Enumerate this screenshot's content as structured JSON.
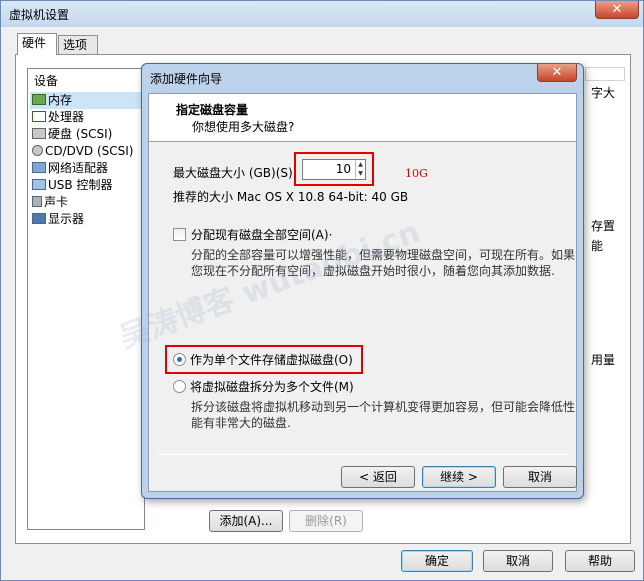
{
  "window": {
    "title": "虚拟机设置",
    "close_symbol": "✕",
    "tabs": [
      "硬件",
      "选项"
    ],
    "device_header": "设备",
    "devices": [
      {
        "label": "内存",
        "icon": "memory-icon",
        "selected": true
      },
      {
        "label": "处理器",
        "icon": "processor-icon"
      },
      {
        "label": "硬盘 (SCSI)",
        "icon": "hard-disk-icon"
      },
      {
        "label": "CD/DVD (SCSI)",
        "icon": "cd-dvd-icon"
      },
      {
        "label": "网络适配器",
        "icon": "network-adapter-icon"
      },
      {
        "label": "USB 控制器",
        "icon": "usb-icon"
      },
      {
        "label": "声卡",
        "icon": "sound-card-icon"
      },
      {
        "label": "显示器",
        "icon": "display-icon"
      }
    ],
    "right_fragments": [
      "字大",
      "存置",
      "能",
      "用量"
    ],
    "add_label": "添加(A)...",
    "remove_label": "删除(R)",
    "ok_label": "确定",
    "cancel_label": "取消",
    "help_label": "帮助"
  },
  "wizard": {
    "title": "添加硬件向导",
    "close_symbol": "✕",
    "heading": "指定磁盘容量",
    "subheading": "你想使用多大磁盘?",
    "max_size_label": "最大磁盘大小 (GB)(S)",
    "max_size_value": "10",
    "spin_up": "▲",
    "spin_down": "▼",
    "annotation": "10G",
    "recommend": "推荐的大小 Mac OS X 10.8 64-bit: 40 GB",
    "allocate_label": "分配现有磁盘全部空间(A)·",
    "allocate_checked": false,
    "allocate_desc": "分配的全部容量可以增强性能，但需要物理磁盘空间，可现在所有。如果您现在不分配所有空间，虚拟磁盘开始时很小，随着您向其添加数据.",
    "single_file_label": "作为单个文件存储虚拟磁盘(O)",
    "split_label": "将虚拟磁盘拆分为多个文件(M)",
    "selected_option": "single",
    "split_desc": "拆分该磁盘将虚拟机移动到另一个计算机变得更加容易，但可能会降低性能有非常大的磁盘.",
    "back_label": "< 返回",
    "next_label": "继续 >",
    "cancel_label": "取消"
  },
  "watermark": "吴涛博客 wutaobi.cn"
}
